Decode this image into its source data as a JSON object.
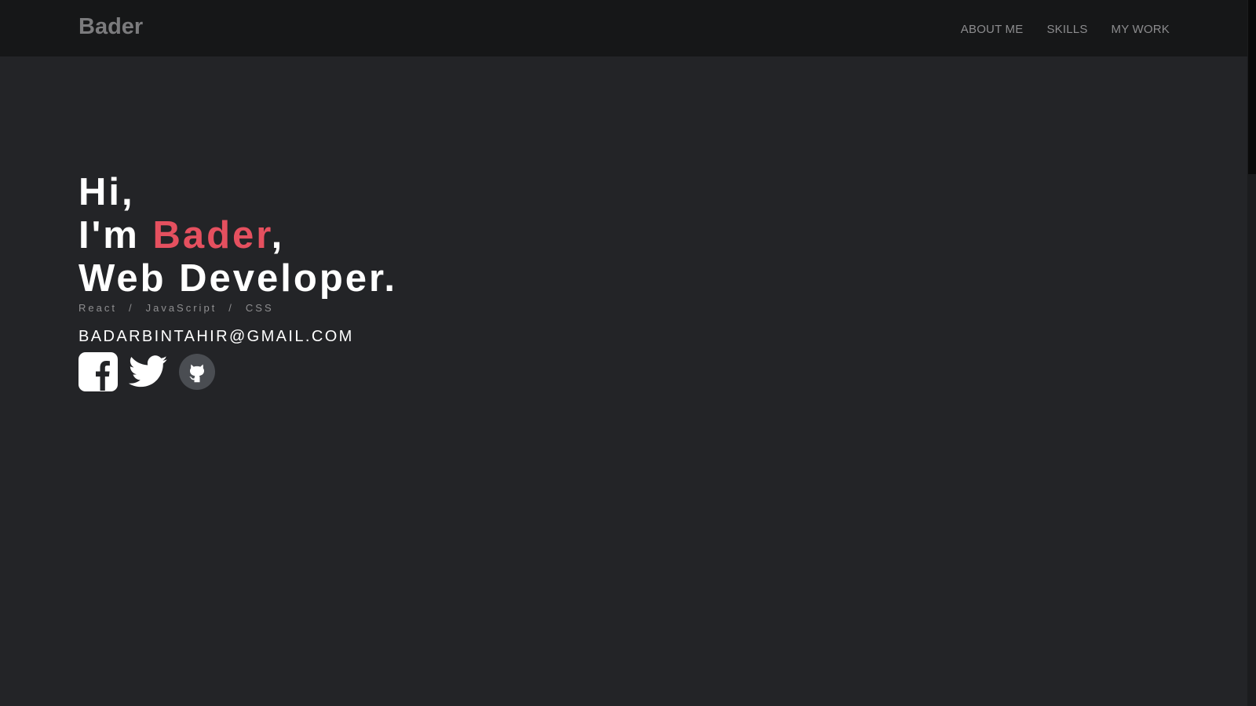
{
  "navbar": {
    "brand": "Bader",
    "links": [
      "ABOUT ME",
      "SKILLS",
      "MY WORK"
    ]
  },
  "hero": {
    "greeting": "Hi,",
    "intro_prefix": "I'm ",
    "name": "Bader",
    "intro_suffix": ",",
    "role": "Web Developer.",
    "skills": [
      "React",
      "JavaScript",
      "CSS"
    ],
    "skills_separator": "/",
    "email": "BADARBINTAHIR@GMAIL.COM"
  },
  "socials": [
    {
      "name": "facebook-icon"
    },
    {
      "name": "twitter-icon"
    },
    {
      "name": "github-icon"
    }
  ],
  "colors": {
    "background": "#232427",
    "navbar": "#161718",
    "accent": "#e5505f",
    "text": "#ffffff",
    "muted": "#8c8c8e"
  }
}
